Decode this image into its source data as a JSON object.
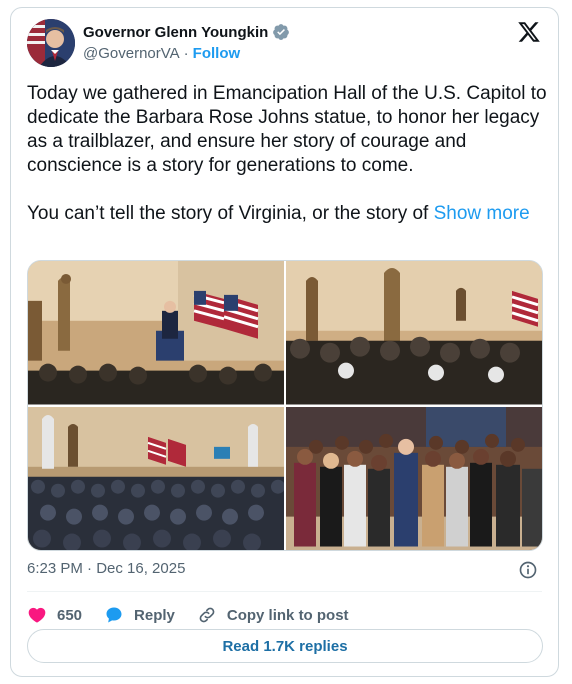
{
  "author": {
    "display_name": "Governor Glenn Youngkin",
    "handle": "@GovernorVA",
    "separator": "·",
    "follow_label": "Follow"
  },
  "tweet": {
    "text": "Today we gathered in Emancipation Hall of the U.S. Capitol to dedicate the Barbara Rose Johns statue, to honor her legacy as a trailblazer, and ensure her story of courage and conscience is a story for generations to come.\n\nYou can’t tell the story of Virginia, or the story of ",
    "show_more_label": "Show more"
  },
  "media": {
    "photos": [
      {
        "alt": "Speaker at podium beside Barbara Rose Johns statue with American flags"
      },
      {
        "alt": "Crowd photographing the statue unveiling in Emancipation Hall"
      },
      {
        "alt": "Wide view of audience seated in Emancipation Hall"
      },
      {
        "alt": "Group photo with the Governor and guests"
      }
    ]
  },
  "meta": {
    "timestamp": "6:23 PM · Dec 16, 2025"
  },
  "actions": {
    "likes": "650",
    "reply_label": "Reply",
    "copy_label": "Copy link to post"
  },
  "footer": {
    "read_replies_label": "Read 1.7K replies"
  },
  "colors": {
    "accent": "#1d9bf0",
    "like": "#f91880",
    "verified": "#829aab"
  },
  "icons": [
    "verified-badge-icon",
    "x-logo-icon",
    "info-icon",
    "heart-icon",
    "reply-bubble-icon",
    "link-icon"
  ]
}
